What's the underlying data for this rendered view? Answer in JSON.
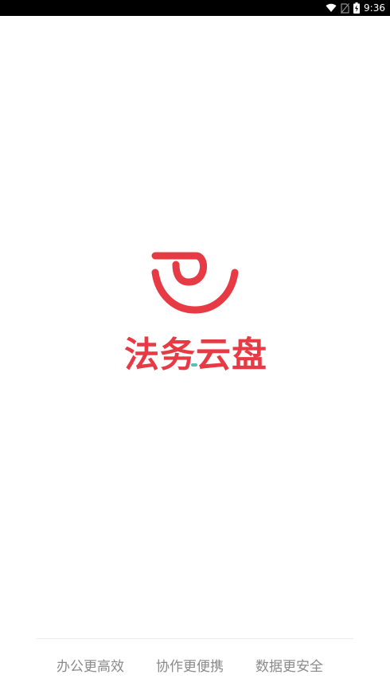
{
  "status_bar": {
    "time": "9:36",
    "icons": [
      "wifi-icon",
      "no-sim-icon",
      "battery-charging-icon"
    ]
  },
  "splash": {
    "app_name": "法务云盘",
    "brand_color": "#e63b45",
    "accent_color": "#56c1b9",
    "logo_icon": "cloud-disk-logo-icon"
  },
  "footer": {
    "slogans": [
      "办公更高效",
      "协作更便携",
      "数据更安全"
    ],
    "text_color": "#8a8a8a"
  }
}
